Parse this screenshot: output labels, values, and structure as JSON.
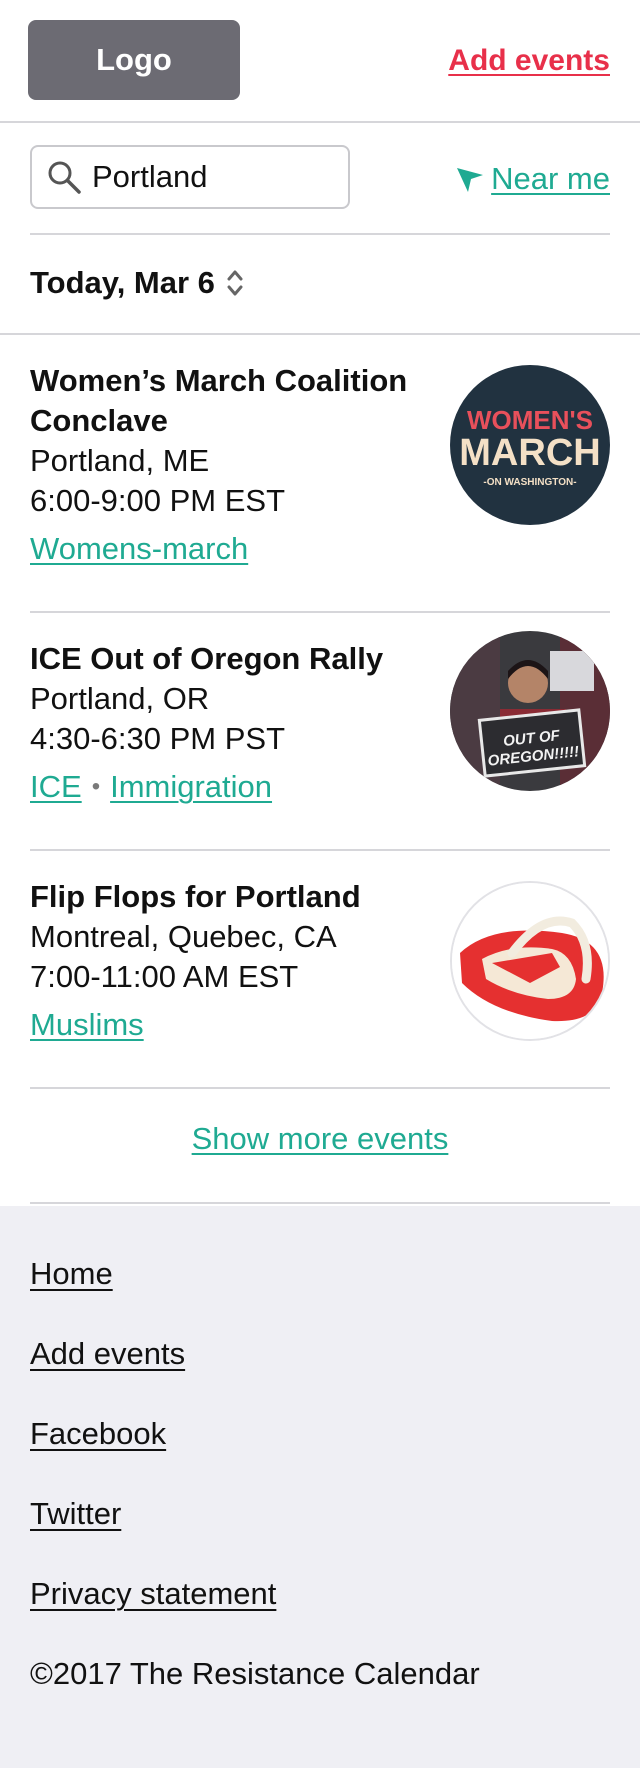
{
  "header": {
    "logo_label": "Logo",
    "add_events_label": "Add events",
    "accent_color": "#e8304a"
  },
  "search": {
    "value": "Portland",
    "near_me_label": "Near me"
  },
  "date_filter": {
    "label": "Today, Mar 6"
  },
  "events": [
    {
      "title": "Women’s March Coalition Conclave",
      "location": "Portland, ME",
      "time": "6:00-9:00 PM EST",
      "tags": [
        "Womens-march"
      ],
      "image_text_main": "WOMEN'S",
      "image_text_second": "MARCH",
      "image_text_sub": "-ON WASHINGTON-"
    },
    {
      "title": "ICE Out of Oregon Rally",
      "location": "Portland, OR",
      "time": "4:30-6:30 PM PST",
      "tags": [
        "ICE",
        "Immigration"
      ],
      "image_sign_line1": "OUT OF",
      "image_sign_line2": "OREGON!!!!!"
    },
    {
      "title": "Flip Flops for Portland",
      "location": "Montreal, Quebec, CA",
      "time": "7:00-11:00 AM EST",
      "tags": [
        "Muslims"
      ]
    }
  ],
  "show_more_label": "Show more events",
  "footer": {
    "links": [
      "Home",
      "Add events",
      "Facebook",
      "Twitter",
      "Privacy statement"
    ],
    "copyright": "©2017 The Resistance Calendar"
  },
  "colors": {
    "link_teal": "#1faa92",
    "footer_bg": "#efeff4",
    "logo_bg": "#6c6b73"
  }
}
